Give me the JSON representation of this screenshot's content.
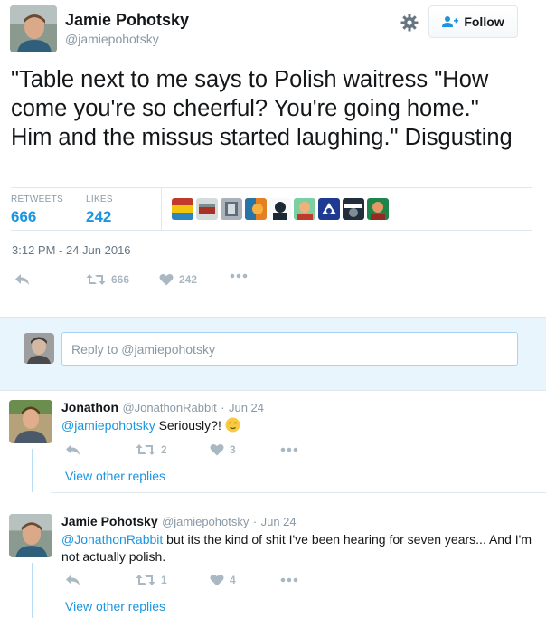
{
  "tweet": {
    "author_name": "Jamie Pohotsky",
    "author_handle": "@jamiepohotsky",
    "text": "\"Table next to me says to Polish waitress \"How come you're so cheerful? You're going home.\" Him and the missus started laughing.\" Disgusting",
    "follow_label": "Follow",
    "retweets_label": "RETWEETS",
    "retweets_value": "666",
    "likes_label": "LIKES",
    "likes_value": "242",
    "timestamp": "3:12 PM - 24 Jun 2016",
    "actions": {
      "retweet_count": "666",
      "like_count": "242"
    },
    "liker_avatars": [
      "liker-1",
      "liker-2",
      "liker-3",
      "liker-4",
      "liker-5",
      "liker-6",
      "liker-7",
      "liker-8",
      "liker-9"
    ]
  },
  "reply_box": {
    "placeholder": "Reply to @jamiepohotsky"
  },
  "replies": [
    {
      "name": "Jonathon",
      "handle": "@JonathonRabbit",
      "date": "Jun 24",
      "mention": "@jamiepohotsky",
      "text": " Seriously?! ",
      "emoji": "relieved-face",
      "retweet_count": "2",
      "like_count": "3",
      "view_replies": "View other replies"
    },
    {
      "name": "Jamie Pohotsky",
      "handle": "@jamiepohotsky",
      "date": "Jun 24",
      "mention": "@JonathonRabbit",
      "text": " but its the kind of shit I've been hearing for seven years... And I'm not actually polish.",
      "retweet_count": "1",
      "like_count": "4",
      "view_replies": "View other replies"
    }
  ],
  "colors": {
    "accent": "#1b95e0",
    "muted": "#8899a6",
    "icon": "#aab8c2",
    "reply_bg": "#e8f5fd"
  }
}
